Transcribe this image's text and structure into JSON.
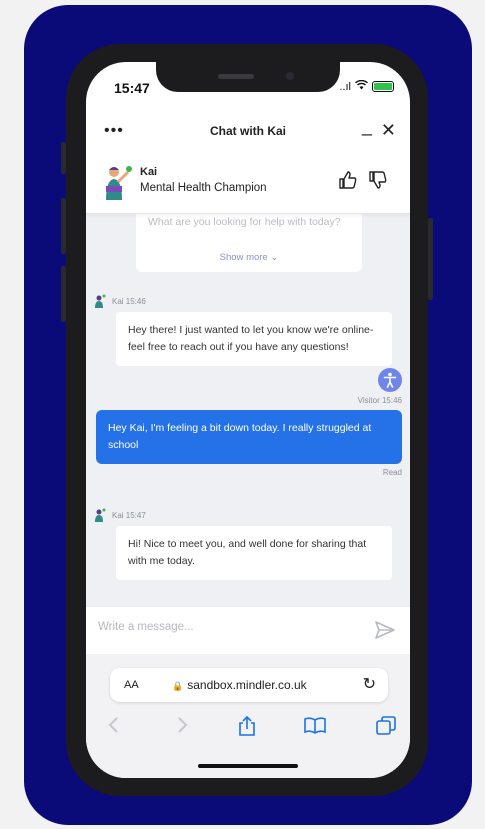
{
  "status_bar": {
    "time": "15:47",
    "signal": "..ıl"
  },
  "chat_header": {
    "menu_label": "•••",
    "title": "Chat with Kai",
    "minimize_label": "_",
    "close_label": "✕"
  },
  "agent": {
    "name": "Kai",
    "role": "Mental Health Champion"
  },
  "previous_card": {
    "text": "What are you looking for help with today?",
    "show_more": "Show more ⌄"
  },
  "messages": [
    {
      "sender": "Kai",
      "time": "15:46",
      "meta": "Kai 15:46",
      "direction": "in",
      "text": "Hey there! I just wanted to let you know we're online- feel free to reach out if you have any questions!"
    },
    {
      "sender": "Visitor",
      "time": "15:46",
      "meta": "Visitor 15:46",
      "direction": "out",
      "text": "Hey Kai, I'm feeling a bit down today. I really struggled at school",
      "receipt": "Read"
    },
    {
      "sender": "Kai",
      "time": "15:47",
      "meta": "Kai 15:47",
      "direction": "in",
      "text": "Hi! Nice to meet you, and well done for sharing that with me today."
    }
  ],
  "composer": {
    "placeholder": "Write a message..."
  },
  "browser": {
    "text_size_label": "AA",
    "url": "sandbox.mindler.co.uk"
  },
  "icons": {
    "thumbs_up": "thumbs-up-icon",
    "thumbs_down": "thumbs-down-icon",
    "send": "send-icon",
    "accessibility": "accessibility-icon",
    "reload": "reload-icon",
    "share": "share-icon",
    "bookmarks": "book-icon",
    "tabs": "tabs-icon"
  },
  "colors": {
    "frame_background": "#0a0a78",
    "visitor_bubble": "#2471e8",
    "chat_background": "#eef0f4",
    "safari_accent": "#1a73e8"
  }
}
